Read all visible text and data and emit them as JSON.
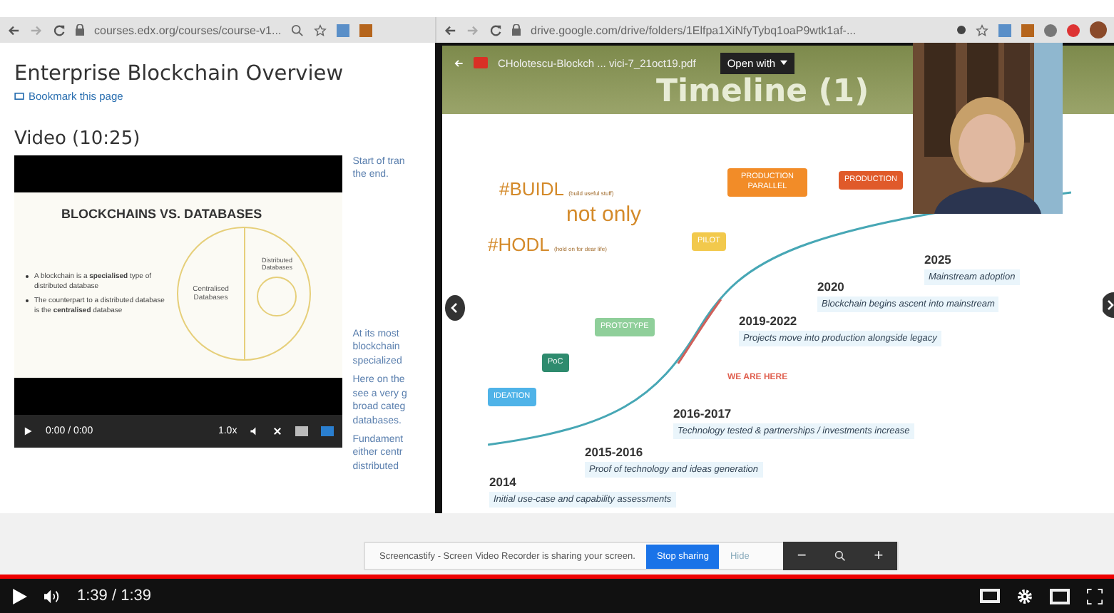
{
  "left_browser": {
    "url": "courses.edx.org/courses/course-v1..."
  },
  "right_browser": {
    "url": "drive.google.com/drive/folders/1Elfpa1XiNfyTybq1oaP9wtk1af-..."
  },
  "course": {
    "title": "Enterprise Blockchain Overview",
    "bookmark": "Bookmark this page",
    "video_heading": "Video (10:25)"
  },
  "course_video": {
    "slide_title": "BLOCKCHAINS VS. DATABASES",
    "bullets": [
      "A blockchain is a **specialised** type of distributed database",
      "The counterpart to a distributed database is the **centralised** database"
    ],
    "left_label": "Centralised Databases",
    "right_label": "Distributed Databases",
    "time": "0:00 / 0:00",
    "speed": "1.0x"
  },
  "transcript": [
    {
      "lines": [
        "Start of tran",
        "the end."
      ]
    },
    {
      "lines": [
        "At its most",
        "blockchain",
        "specialized"
      ]
    },
    {
      "lines": [
        "Here on the",
        "see a very g",
        "broad categ",
        "databases."
      ]
    },
    {
      "lines": [
        "Fundament",
        "either centr",
        "distributed"
      ]
    }
  ],
  "viewer": {
    "file_name": "CHolotescu-Blockch ... vici-7_21oct19.pdf",
    "open_with": "Open with",
    "slide_title": "Timeline (1)"
  },
  "slogan": {
    "first": "#BUIDL",
    "first_note": "(build useful stuff)",
    "middle": "not only",
    "second": "#HODL",
    "second_note": "(hold on for dear life)"
  },
  "timeline": {
    "marker": "WE ARE HERE",
    "stages": [
      {
        "label": "IDEATION",
        "color": "#4fb3e8"
      },
      {
        "label": "PoC",
        "color": "#2e8b6e"
      },
      {
        "label": "PROTOTYPE",
        "color": "#8fcf9a"
      },
      {
        "label": "PILOT",
        "color": "#f2c94c"
      },
      {
        "label": "PRODUCTION PARALLEL",
        "color": "#f28c28"
      },
      {
        "label": "PRODUCTION",
        "color": "#e05a2a"
      }
    ],
    "milestones": [
      {
        "year": "2025",
        "text": "Mainstream adoption"
      },
      {
        "year": "2020",
        "text": "Blockchain begins ascent into mainstream"
      },
      {
        "year": "2019-2022",
        "text": "Projects move into production alongside legacy"
      },
      {
        "year": "2016-2017",
        "text": "Technology tested & partnerships / investments increase"
      },
      {
        "year": "2015-2016",
        "text": "Proof of technology and ideas generation"
      },
      {
        "year": "2014",
        "text": "Initial use-case and capability assessments"
      }
    ]
  },
  "share_notice": {
    "message": "Screencastify - Screen Video Recorder is sharing your screen.",
    "stop": "Stop sharing",
    "hide": "Hide",
    "zoom_out": "−",
    "zoom_in": "+"
  },
  "player": {
    "time": "1:39 / 1:39",
    "level": 1
  }
}
